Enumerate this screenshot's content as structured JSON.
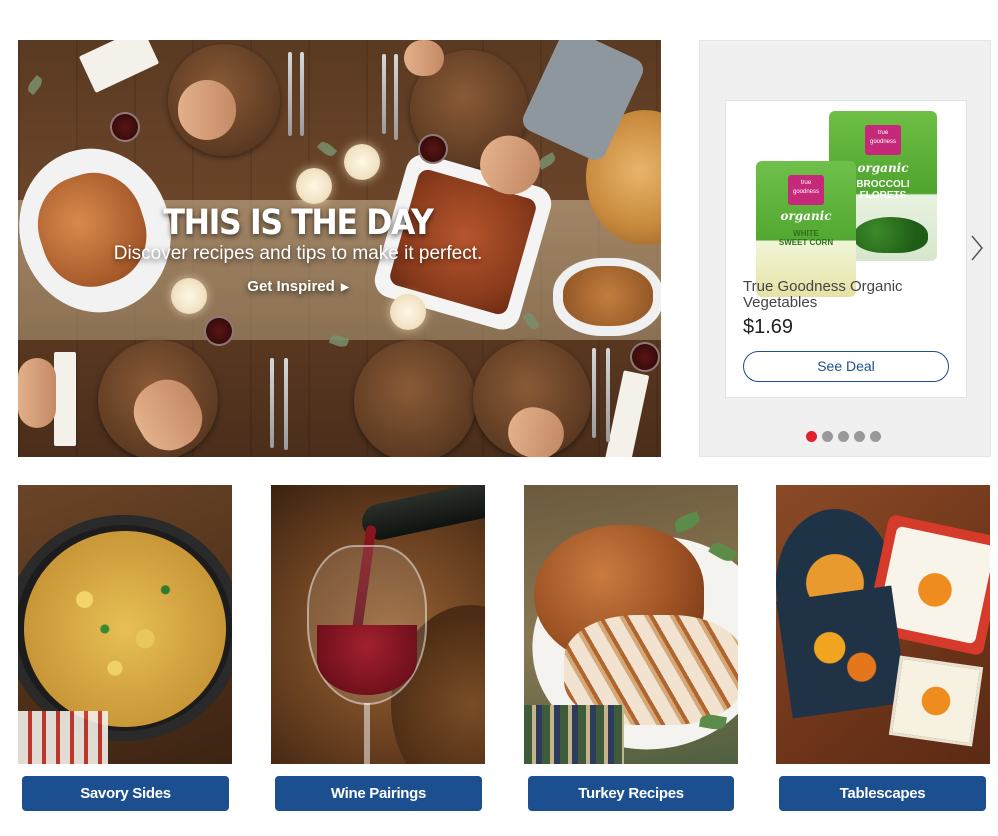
{
  "hero": {
    "title": "THIS IS THE DAY",
    "subtitle": "Discover recipes and tips to make it perfect.",
    "cta_label": "Get Inspired"
  },
  "deal": {
    "product_title": "True Goodness Organic Vegetables",
    "price": "$1.69",
    "button_label": "See Deal",
    "package_back": {
      "brand_line1": "true",
      "brand_line2": "goodness",
      "organic": "organic",
      "veg_line1": "BROCCOLI",
      "veg_line2": "FLORETS"
    },
    "package_front": {
      "brand_line1": "true",
      "brand_line2": "goodness",
      "organic": "organic",
      "veg_line1": "WHITE",
      "veg_line2": "SWEET CORN"
    },
    "carousel": {
      "slide_count": 5,
      "active_index": 0,
      "active_color": "#e0212f",
      "inactive_color": "#999999"
    }
  },
  "categories": [
    {
      "label": "Savory Sides"
    },
    {
      "label": "Wine Pairings"
    },
    {
      "label": "Turkey Recipes"
    },
    {
      "label": "Tablescapes"
    }
  ],
  "theme": {
    "button_blue": "#1b4f8f",
    "link_blue": "#1f4f8c"
  },
  "icons": {
    "hero_cta_caret": "caret-right-icon",
    "carousel_next": "chevron-right-icon"
  }
}
